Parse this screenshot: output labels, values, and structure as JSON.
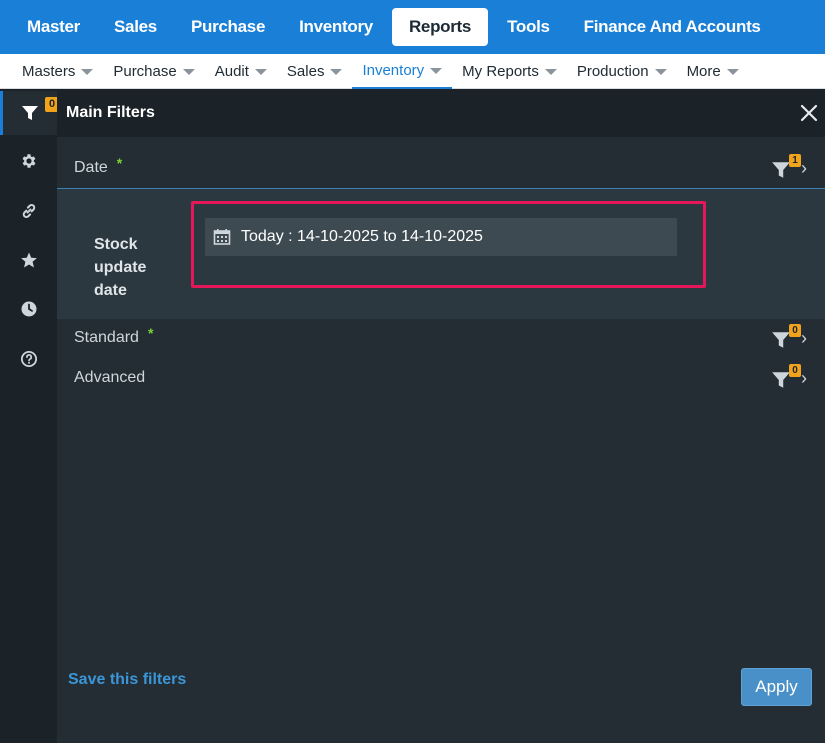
{
  "topnav": {
    "items": [
      {
        "label": "Master"
      },
      {
        "label": "Sales"
      },
      {
        "label": "Purchase"
      },
      {
        "label": "Inventory"
      },
      {
        "label": "Reports",
        "active": true
      },
      {
        "label": "Tools"
      },
      {
        "label": "Finance And Accounts"
      }
    ]
  },
  "subnav": {
    "items": [
      {
        "label": "Masters"
      },
      {
        "label": "Purchase"
      },
      {
        "label": "Audit"
      },
      {
        "label": "Sales"
      },
      {
        "label": "Inventory",
        "active": true
      },
      {
        "label": "My Reports"
      },
      {
        "label": "Production"
      },
      {
        "label": "More"
      }
    ]
  },
  "rail": {
    "filter_count": "0",
    "icons": [
      "filter-icon",
      "gear-icon",
      "link-icon",
      "star-icon",
      "clock-icon",
      "help-icon"
    ]
  },
  "panel": {
    "title": "Main Filters",
    "sections": {
      "date": {
        "label": "Date",
        "required": "*",
        "count": "1"
      },
      "standard": {
        "label": "Standard",
        "required": "*",
        "count": "0"
      },
      "advanced": {
        "label": "Advanced",
        "count": "0"
      }
    },
    "date_field": {
      "label": "Stock update date",
      "value": "Today : 14-10-2025 to 14-10-2025"
    },
    "save_label": "Save this filters",
    "apply_label": "Apply"
  },
  "colors": {
    "accent": "#1a7fd6",
    "badge": "#f0a31b",
    "highlight": "#e5175a",
    "required": "#7ad13a"
  }
}
